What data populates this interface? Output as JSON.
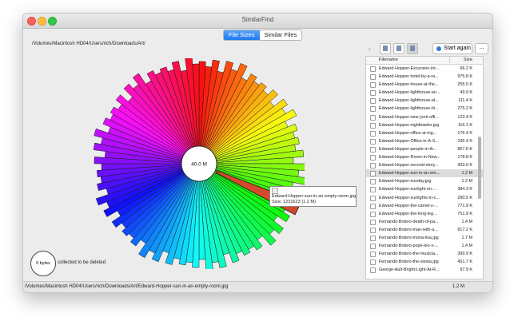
{
  "window": {
    "title": "SimilarFind"
  },
  "tabs": [
    {
      "label": "File Sizes",
      "active": true
    },
    {
      "label": "Similar Files",
      "active": false
    }
  ],
  "path": "/Volumes/Macintosh HD04/Users/rich/Downloads/Art/",
  "chart": {
    "center_label": "40.0 M",
    "tooltip": {
      "name": "Edward-Hopper-sun-in-an-empty-room.jpg",
      "size": "Size: 1231623 (1.2 M)"
    }
  },
  "deleted": {
    "amount": "0 bytes",
    "label": "collected to be deleted"
  },
  "toolbar": {
    "back_icon": "‹",
    "start_label": "Start again",
    "more_label": "..."
  },
  "file_list": {
    "headers": {
      "name": "Filename",
      "size": "Size"
    },
    "selected_index": 14,
    "rows": [
      {
        "name": "Edward-Hopper-Excursion-int...",
        "size": "66.2 K"
      },
      {
        "name": "Edward-Hopper-hotel-by-a-ra...",
        "size": "975.8 K"
      },
      {
        "name": "Edward-Hopper-house-at-the...",
        "size": "255.5 K"
      },
      {
        "name": "Edward-Hopper-lighthouse-an...",
        "size": "49.9 K"
      },
      {
        "name": "Edward-Hopper-lighthouse-at...",
        "size": "111.4 K"
      },
      {
        "name": "Edward-Hopper-lighthouse-hi...",
        "size": "275.2 K"
      },
      {
        "name": "Edward-Hopper-new-york-offi...",
        "size": "123.4 K"
      },
      {
        "name": "Edward-Hopper-nighthawks.jpg",
        "size": "116.1 K"
      },
      {
        "name": "Edward-Hopper-office-at-nig...",
        "size": "176.4 K"
      },
      {
        "name": "Edward-Hopper-Office-in-A-S...",
        "size": "236.4 K"
      },
      {
        "name": "Edward-Hopper-people-in-th...",
        "size": "857.6 K"
      },
      {
        "name": "Edward-Hopper-Room-in-New...",
        "size": "178.8 K"
      },
      {
        "name": "Edward-Hopper-second-story...",
        "size": "993.0 K"
      },
      {
        "name": "Edward-Hopper-sun-in-an-em...",
        "size": "1.2 M"
      },
      {
        "name": "Edward-Hopper-sunday.jpg",
        "size": "1.2 M"
      },
      {
        "name": "Edward-Hopper-sunlight-on-...",
        "size": "384.3 K"
      },
      {
        "name": "Edward-Hopper-sunlights-in-c...",
        "size": "290.5 K"
      },
      {
        "name": "Edward-Hopper-the-camel-s-...",
        "size": "771.9 K"
      },
      {
        "name": "Edward-Hopper-the-long-leg...",
        "size": "751.9 K"
      },
      {
        "name": "Fernando-Botero-death-of-pa...",
        "size": "1.4 M"
      },
      {
        "name": "Fernando-Botero-man-with-a...",
        "size": "817.2 K"
      },
      {
        "name": "Fernando-Botero-mona-lisa.jpg",
        "size": "1.7 M"
      },
      {
        "name": "Fernando-Botero-pope-leo-x-...",
        "size": "1.4 M"
      },
      {
        "name": "Fernando-Botero-the-musicia...",
        "size": "399.9 K"
      },
      {
        "name": "Fernando-Botero-the-siesta.jpg",
        "size": "451.7 K"
      },
      {
        "name": "George-Ault-Bright-Light-At-R...",
        "size": "97.9 K"
      }
    ]
  },
  "status": {
    "path": "/Volumes/Macintosh HD04/Users/rich/Downloads/Art/Edward-Hopper-sun-in-an-empty-room.jpg",
    "size": "1.2 M"
  },
  "colors": {
    "accent": "#1f79ef",
    "selected_slice": "#d24a2b"
  }
}
